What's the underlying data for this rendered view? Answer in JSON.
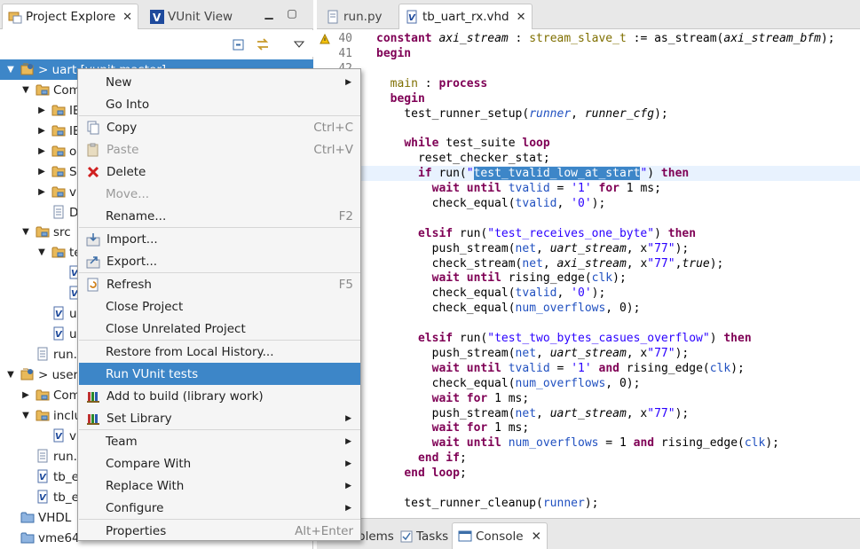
{
  "left_panel": {
    "tabs": [
      {
        "label": "Project Explore",
        "active": true
      },
      {
        "label": "VUnit View",
        "active": false
      }
    ],
    "tree": [
      {
        "label": "> uart [vunit master]",
        "level": 0,
        "expanded": true,
        "icon": "project-icon",
        "selected": true
      },
      {
        "label": "Com",
        "level": 1,
        "expanded": true,
        "icon": "folder-icon"
      },
      {
        "label": "IE",
        "level": 2,
        "expanded": false,
        "icon": "folder-icon"
      },
      {
        "label": "IE",
        "level": 2,
        "expanded": false,
        "icon": "folder-icon"
      },
      {
        "label": "o",
        "level": 2,
        "expanded": false,
        "icon": "folder-icon"
      },
      {
        "label": "S",
        "level": 2,
        "expanded": false,
        "icon": "folder-icon"
      },
      {
        "label": "v",
        "level": 2,
        "expanded": false,
        "icon": "folder-icon"
      },
      {
        "label": "D",
        "level": 2,
        "icon": "file-icon"
      },
      {
        "label": "src",
        "level": 1,
        "expanded": true,
        "icon": "folder-icon"
      },
      {
        "label": "te",
        "level": 2,
        "expanded": true,
        "icon": "folder-icon"
      },
      {
        "label": "",
        "level": 3,
        "icon": "vhdl-file-icon"
      },
      {
        "label": "",
        "level": 3,
        "icon": "vhdl-file-icon"
      },
      {
        "label": "u",
        "level": 2,
        "icon": "vhdl-file-icon"
      },
      {
        "label": "u",
        "level": 2,
        "icon": "vhdl-file-icon"
      },
      {
        "label": "run.",
        "level": 1,
        "icon": "file-icon"
      },
      {
        "label": "> user",
        "level": 0,
        "expanded": true,
        "icon": "project-icon"
      },
      {
        "label": "Com",
        "level": 1,
        "expanded": false,
        "icon": "folder-icon"
      },
      {
        "label": "inclu",
        "level": 1,
        "expanded": true,
        "icon": "folder-icon"
      },
      {
        "label": "v",
        "level": 2,
        "icon": "vhdl-file-icon"
      },
      {
        "label": "run.",
        "level": 1,
        "icon": "file-icon"
      },
      {
        "label": "tb_e",
        "level": 1,
        "icon": "vhdl-file-icon"
      },
      {
        "label": "tb_e",
        "level": 1,
        "icon": "vhdl-file-icon"
      },
      {
        "label": "VHDL",
        "level": 0,
        "icon": "project-folder-icon"
      },
      {
        "label": "vme64",
        "level": 0,
        "icon": "project-folder-icon"
      }
    ]
  },
  "editor": {
    "tabs": [
      {
        "label": "run.py",
        "active": false
      },
      {
        "label": "tb_uart_rx.vhd",
        "active": true
      }
    ],
    "lines": [
      {
        "no": "40",
        "html": "<span class=\"kw\">constant</span> <span class=\"it\">axi_stream</span> : <span class=\"typ\">stream_slave_t</span> := as_stream(<span class=\"it\">axi_stream_bfm</span>);"
      },
      {
        "no": "41",
        "html": "<span class=\"kw\">begin</span>"
      },
      {
        "no": "42",
        "html": ""
      },
      {
        "no": "",
        "html": "  <span class=\"typ\">main</span> : <span class=\"kw\">process</span>"
      },
      {
        "no": "",
        "html": "  <span class=\"kw\">begin</span>"
      },
      {
        "no": "",
        "html": "    test_runner_setup(<span class=\"blue it\">runner</span>, <span class=\"it\">runner_cfg</span>);"
      },
      {
        "no": "",
        "html": ""
      },
      {
        "no": "",
        "html": "    <span class=\"kw\">while</span> test_suite <span class=\"kw\">loop</span>"
      },
      {
        "no": "",
        "html": "      reset_checker_stat;"
      },
      {
        "no": "",
        "html": "      <span class=\"kw\">if</span> run(<span class=\"str\">\"</span><span class=\"sel\">test_tvalid_low_at_start</span><span class=\"str\">\"</span>) <span class=\"kw\">then</span>",
        "current": true
      },
      {
        "no": "",
        "html": "        <span class=\"kw\">wait until</span> <span class=\"blue\">tvalid</span> = <span class=\"str\">'1'</span> <span class=\"kw\">for</span> 1 ms;"
      },
      {
        "no": "",
        "html": "        check_equal(<span class=\"blue\">tvalid</span>, <span class=\"str\">'0'</span>);"
      },
      {
        "no": "",
        "html": ""
      },
      {
        "no": "",
        "html": "      <span class=\"kw\">elsif</span> run(<span class=\"str\">\"test_receives_one_byte\"</span>) <span class=\"kw\">then</span>"
      },
      {
        "no": "",
        "html": "        push_stream(<span class=\"blue\">net</span>, <span class=\"it\">uart_stream</span>, x<span class=\"str\">\"77\"</span>);"
      },
      {
        "no": "",
        "html": "        check_stream(<span class=\"blue\">net</span>, <span class=\"it\">axi_stream</span>, x<span class=\"str\">\"77\"</span>,<span class=\"it\">true</span>);"
      },
      {
        "no": "",
        "html": "        <span class=\"kw\">wait until</span> rising_edge(<span class=\"blue\">clk</span>);"
      },
      {
        "no": "",
        "html": "        check_equal(<span class=\"blue\">tvalid</span>, <span class=\"str\">'0'</span>);"
      },
      {
        "no": "",
        "html": "        check_equal(<span class=\"blue\">num_overflows</span>, 0);"
      },
      {
        "no": "",
        "html": ""
      },
      {
        "no": "",
        "html": "      <span class=\"kw\">elsif</span> run(<span class=\"str\">\"test_two_bytes_casues_overflow\"</span>) <span class=\"kw\">then</span>"
      },
      {
        "no": "",
        "html": "        push_stream(<span class=\"blue\">net</span>, <span class=\"it\">uart_stream</span>, x<span class=\"str\">\"77\"</span>);"
      },
      {
        "no": "",
        "html": "        <span class=\"kw\">wait until</span> <span class=\"blue\">tvalid</span> = <span class=\"str\">'1'</span> <span class=\"kw\">and</span> rising_edge(<span class=\"blue\">clk</span>);"
      },
      {
        "no": "",
        "html": "        check_equal(<span class=\"blue\">num_overflows</span>, 0);"
      },
      {
        "no": "",
        "html": "        <span class=\"kw\">wait for</span> 1 ms;"
      },
      {
        "no": "",
        "html": "        push_stream(<span class=\"blue\">net</span>, <span class=\"it\">uart_stream</span>, x<span class=\"str\">\"77\"</span>);"
      },
      {
        "no": "",
        "html": "        <span class=\"kw\">wait for</span> 1 ms;"
      },
      {
        "no": "",
        "html": "        <span class=\"kw\">wait until</span> <span class=\"blue\">num_overflows</span> = 1 <span class=\"kw\">and</span> rising_edge(<span class=\"blue\">clk</span>);"
      },
      {
        "no": "",
        "html": "      <span class=\"kw\">end if</span>;"
      },
      {
        "no": "",
        "html": "    <span class=\"kw\">end loop</span>;"
      },
      {
        "no": "",
        "html": ""
      },
      {
        "no": "",
        "html": "    test_runner_cleanup(<span class=\"blue\">runner</span>);"
      }
    ]
  },
  "bottom_panel": {
    "tabs": [
      {
        "label": "blems",
        "active": false
      },
      {
        "label": "Tasks",
        "active": false
      },
      {
        "label": "Console",
        "active": true
      }
    ]
  },
  "context_menu": {
    "items": [
      {
        "label": "New",
        "accel": "",
        "submenu": true,
        "icon": ""
      },
      {
        "label": "Go Into",
        "accel": "",
        "submenu": false,
        "icon": ""
      },
      {
        "sep": true
      },
      {
        "label": "Copy",
        "accel": "Ctrl+C",
        "icon": "copy-icon"
      },
      {
        "label": "Paste",
        "accel": "Ctrl+V",
        "icon": "paste-icon",
        "disabled": true
      },
      {
        "label": "Delete",
        "accel": "",
        "icon": "delete-icon"
      },
      {
        "label": "Move...",
        "accel": "",
        "icon": "",
        "disabled": true
      },
      {
        "label": "Rename...",
        "accel": "F2",
        "icon": ""
      },
      {
        "sep": true
      },
      {
        "label": "Import...",
        "accel": "",
        "icon": "import-icon"
      },
      {
        "label": "Export...",
        "accel": "",
        "icon": "export-icon"
      },
      {
        "sep": true
      },
      {
        "label": "Refresh",
        "accel": "F5",
        "icon": "refresh-icon"
      },
      {
        "label": "Close Project",
        "accel": "",
        "icon": ""
      },
      {
        "label": "Close Unrelated Project",
        "accel": "",
        "icon": ""
      },
      {
        "sep": true
      },
      {
        "label": "Restore from Local History...",
        "accel": "",
        "icon": ""
      },
      {
        "label": "Run VUnit tests",
        "accel": "",
        "icon": "",
        "highlighted": true
      },
      {
        "label": "Add to build (library work)",
        "accel": "",
        "icon": "library-icon"
      },
      {
        "label": "Set Library",
        "accel": "",
        "icon": "library-icon",
        "submenu": true
      },
      {
        "sep": true
      },
      {
        "label": "Team",
        "accel": "",
        "icon": "",
        "submenu": true
      },
      {
        "label": "Compare With",
        "accel": "",
        "icon": "",
        "submenu": true
      },
      {
        "label": "Replace With",
        "accel": "",
        "icon": "",
        "submenu": true
      },
      {
        "label": "Configure",
        "accel": "",
        "icon": "",
        "submenu": true
      },
      {
        "sep": true
      },
      {
        "label": "Properties",
        "accel": "Alt+Enter",
        "icon": ""
      }
    ]
  },
  "colors": {
    "selection": "#3d86c8",
    "keyword": "#7f0055",
    "string": "#2a00ff"
  }
}
